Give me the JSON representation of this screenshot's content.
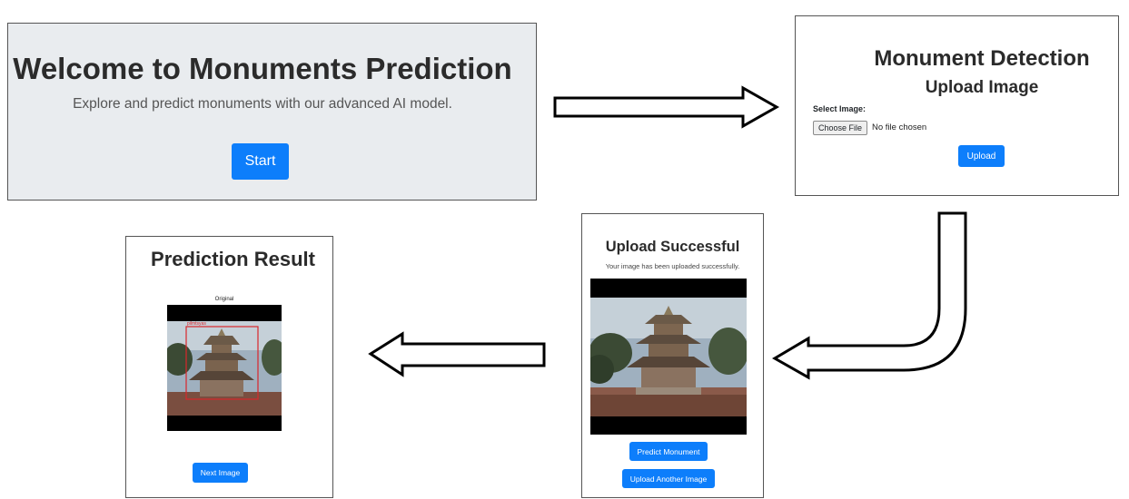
{
  "welcome": {
    "title": "Welcome to Monuments Prediction",
    "subtitle": "Explore and predict monuments with our advanced AI model.",
    "start_label": "Start"
  },
  "upload": {
    "title": "Monument Detection",
    "subtitle": "Upload Image",
    "select_label": "Select Image:",
    "choose_file_label": "Choose File",
    "file_status": "No file chosen",
    "upload_label": "Upload"
  },
  "success": {
    "title": "Upload Successful",
    "message": "Your image has been uploaded successfully.",
    "predict_label": "Predict Monument",
    "upload_another_label": "Upload Another Image"
  },
  "result": {
    "title": "Prediction Result",
    "image_caption": "Original",
    "detection_label": "pilmtsyas",
    "next_label": "Next Image"
  },
  "colors": {
    "primary_button": "#0d7efb",
    "welcome_background": "#e9ecef",
    "detection_box": "#d9262b"
  }
}
